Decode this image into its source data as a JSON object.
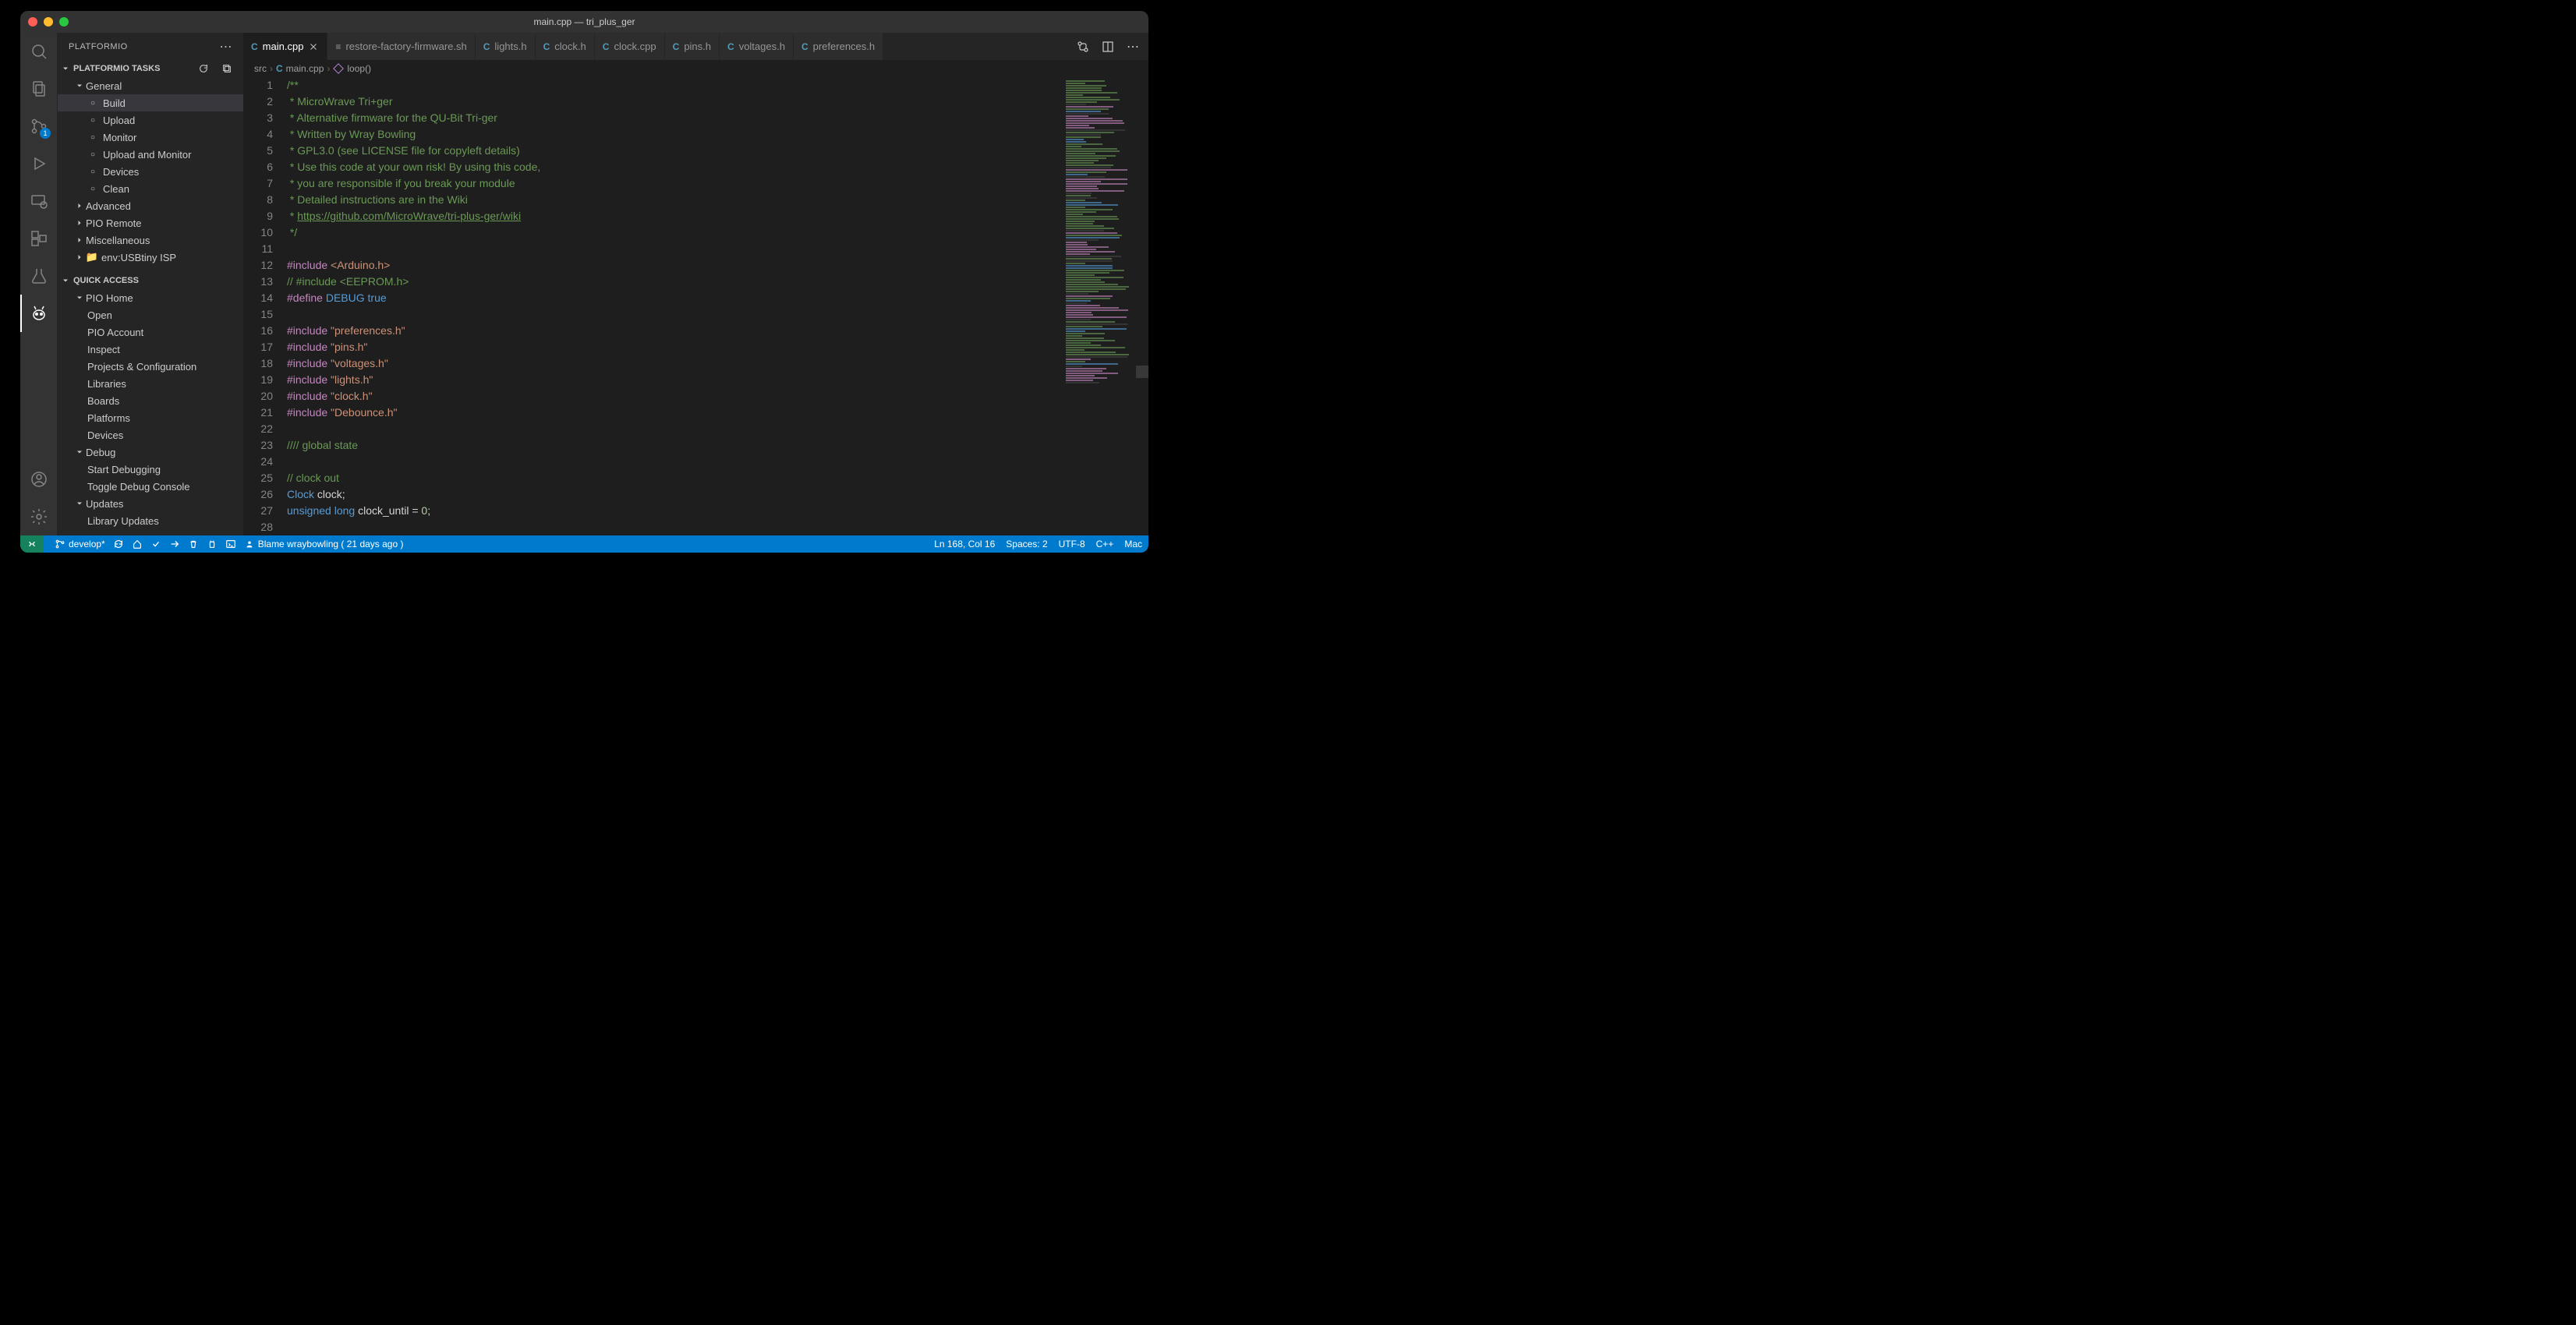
{
  "window_title": "main.cpp — tri_plus_ger",
  "sidebar": {
    "title": "PLATFORMIO",
    "section1_title": "PLATFORMIO TASKS",
    "tasks": {
      "general": "General",
      "build": "Build",
      "upload": "Upload",
      "monitor": "Monitor",
      "upload_monitor": "Upload and Monitor",
      "devices": "Devices",
      "clean": "Clean",
      "advanced": "Advanced",
      "pio_remote": "PIO Remote",
      "misc": "Miscellaneous",
      "env": "env:USBtiny ISP"
    },
    "section2_title": "QUICK ACCESS",
    "qa": {
      "pio_home": "PIO Home",
      "open": "Open",
      "pio_account": "PIO Account",
      "inspect": "Inspect",
      "projects": "Projects & Configuration",
      "libraries": "Libraries",
      "boards": "Boards",
      "platforms": "Platforms",
      "devices": "Devices",
      "debug": "Debug",
      "start_debug": "Start Debugging",
      "toggle_debug": "Toggle Debug Console",
      "updates": "Updates",
      "lib_updates": "Library Updates"
    }
  },
  "tabs": [
    {
      "icon": "C",
      "label": "main.cpp",
      "active": true
    },
    {
      "icon": "$",
      "label": "restore-factory-firmware.sh"
    },
    {
      "icon": "C",
      "label": "lights.h"
    },
    {
      "icon": "C",
      "label": "clock.h"
    },
    {
      "icon": "C",
      "label": "clock.cpp"
    },
    {
      "icon": "C",
      "label": "pins.h"
    },
    {
      "icon": "C",
      "label": "voltages.h"
    },
    {
      "icon": "C",
      "label": "preferences.h"
    }
  ],
  "breadcrumb": {
    "p1": "src",
    "p2": "main.cpp",
    "p3": "loop()"
  },
  "code_lines": [
    {
      "n": 1,
      "html": "<span class='c-comment'>/**</span>"
    },
    {
      "n": 2,
      "html": "<span class='c-comment'> * MicroWrave Tri+ger</span>"
    },
    {
      "n": 3,
      "html": "<span class='c-comment'> * Alternative firmware for the QU-Bit Tri-ger</span>"
    },
    {
      "n": 4,
      "html": "<span class='c-comment'> * Written by Wray Bowling</span>"
    },
    {
      "n": 5,
      "html": "<span class='c-comment'> * GPL3.0 (see LICENSE file for copyleft details)</span>"
    },
    {
      "n": 6,
      "html": "<span class='c-comment'> * Use this code at your own risk! By using this code,</span>"
    },
    {
      "n": 7,
      "html": "<span class='c-comment'> * you are responsible if you break your module</span>"
    },
    {
      "n": 8,
      "html": "<span class='c-comment'> * Detailed instructions are in the Wiki</span>"
    },
    {
      "n": 9,
      "html": "<span class='c-comment'> * <span class='c-link'>https://github.com/MicroWrave/tri-plus-ger/wiki</span></span>"
    },
    {
      "n": 10,
      "html": "<span class='c-comment'> */</span>"
    },
    {
      "n": 11,
      "html": ""
    },
    {
      "n": 12,
      "html": "<span class='c-keyword'>#include</span> <span class='c-string'>&lt;Arduino.h&gt;</span>"
    },
    {
      "n": 13,
      "html": "<span class='c-comment'>// #include &lt;EEPROM.h&gt;</span>"
    },
    {
      "n": 14,
      "html": "<span class='c-keyword'>#define</span> <span class='c-macro'>DEBUG</span> <span class='c-type'>true</span>"
    },
    {
      "n": 15,
      "html": ""
    },
    {
      "n": 16,
      "html": "<span class='c-keyword'>#include</span> <span class='c-string'>\"preferences.h\"</span>"
    },
    {
      "n": 17,
      "html": "<span class='c-keyword'>#include</span> <span class='c-string'>\"pins.h\"</span>"
    },
    {
      "n": 18,
      "html": "<span class='c-keyword'>#include</span> <span class='c-string'>\"voltages.h\"</span>"
    },
    {
      "n": 19,
      "html": "<span class='c-keyword'>#include</span> <span class='c-string'>\"lights.h\"</span>"
    },
    {
      "n": 20,
      "html": "<span class='c-keyword'>#include</span> <span class='c-string'>\"clock.h\"</span>"
    },
    {
      "n": 21,
      "html": "<span class='c-keyword'>#include</span> <span class='c-string'>\"Debounce.h\"</span>"
    },
    {
      "n": 22,
      "html": ""
    },
    {
      "n": 23,
      "html": "<span class='c-comment'>//// global state</span>"
    },
    {
      "n": 24,
      "html": ""
    },
    {
      "n": 25,
      "html": "<span class='c-comment'>// clock out</span>"
    },
    {
      "n": 26,
      "html": "<span class='c-type'>Clock</span> <span class='c-op'>clock;</span>"
    },
    {
      "n": 27,
      "html": "<span class='c-type'>unsigned</span> <span class='c-type'>long</span> <span class='c-op'>clock_until = </span><span class='c-num'>0</span><span class='c-op'>;</span>"
    },
    {
      "n": 28,
      "html": ""
    }
  ],
  "status": {
    "branch": "develop*",
    "blame": "Blame wraybowling ( 21 days ago )",
    "pos": "Ln 168, Col 16",
    "spaces": "Spaces: 2",
    "enc": "UTF-8",
    "lang": "C++",
    "os": "Mac"
  },
  "scm_badge": "1"
}
